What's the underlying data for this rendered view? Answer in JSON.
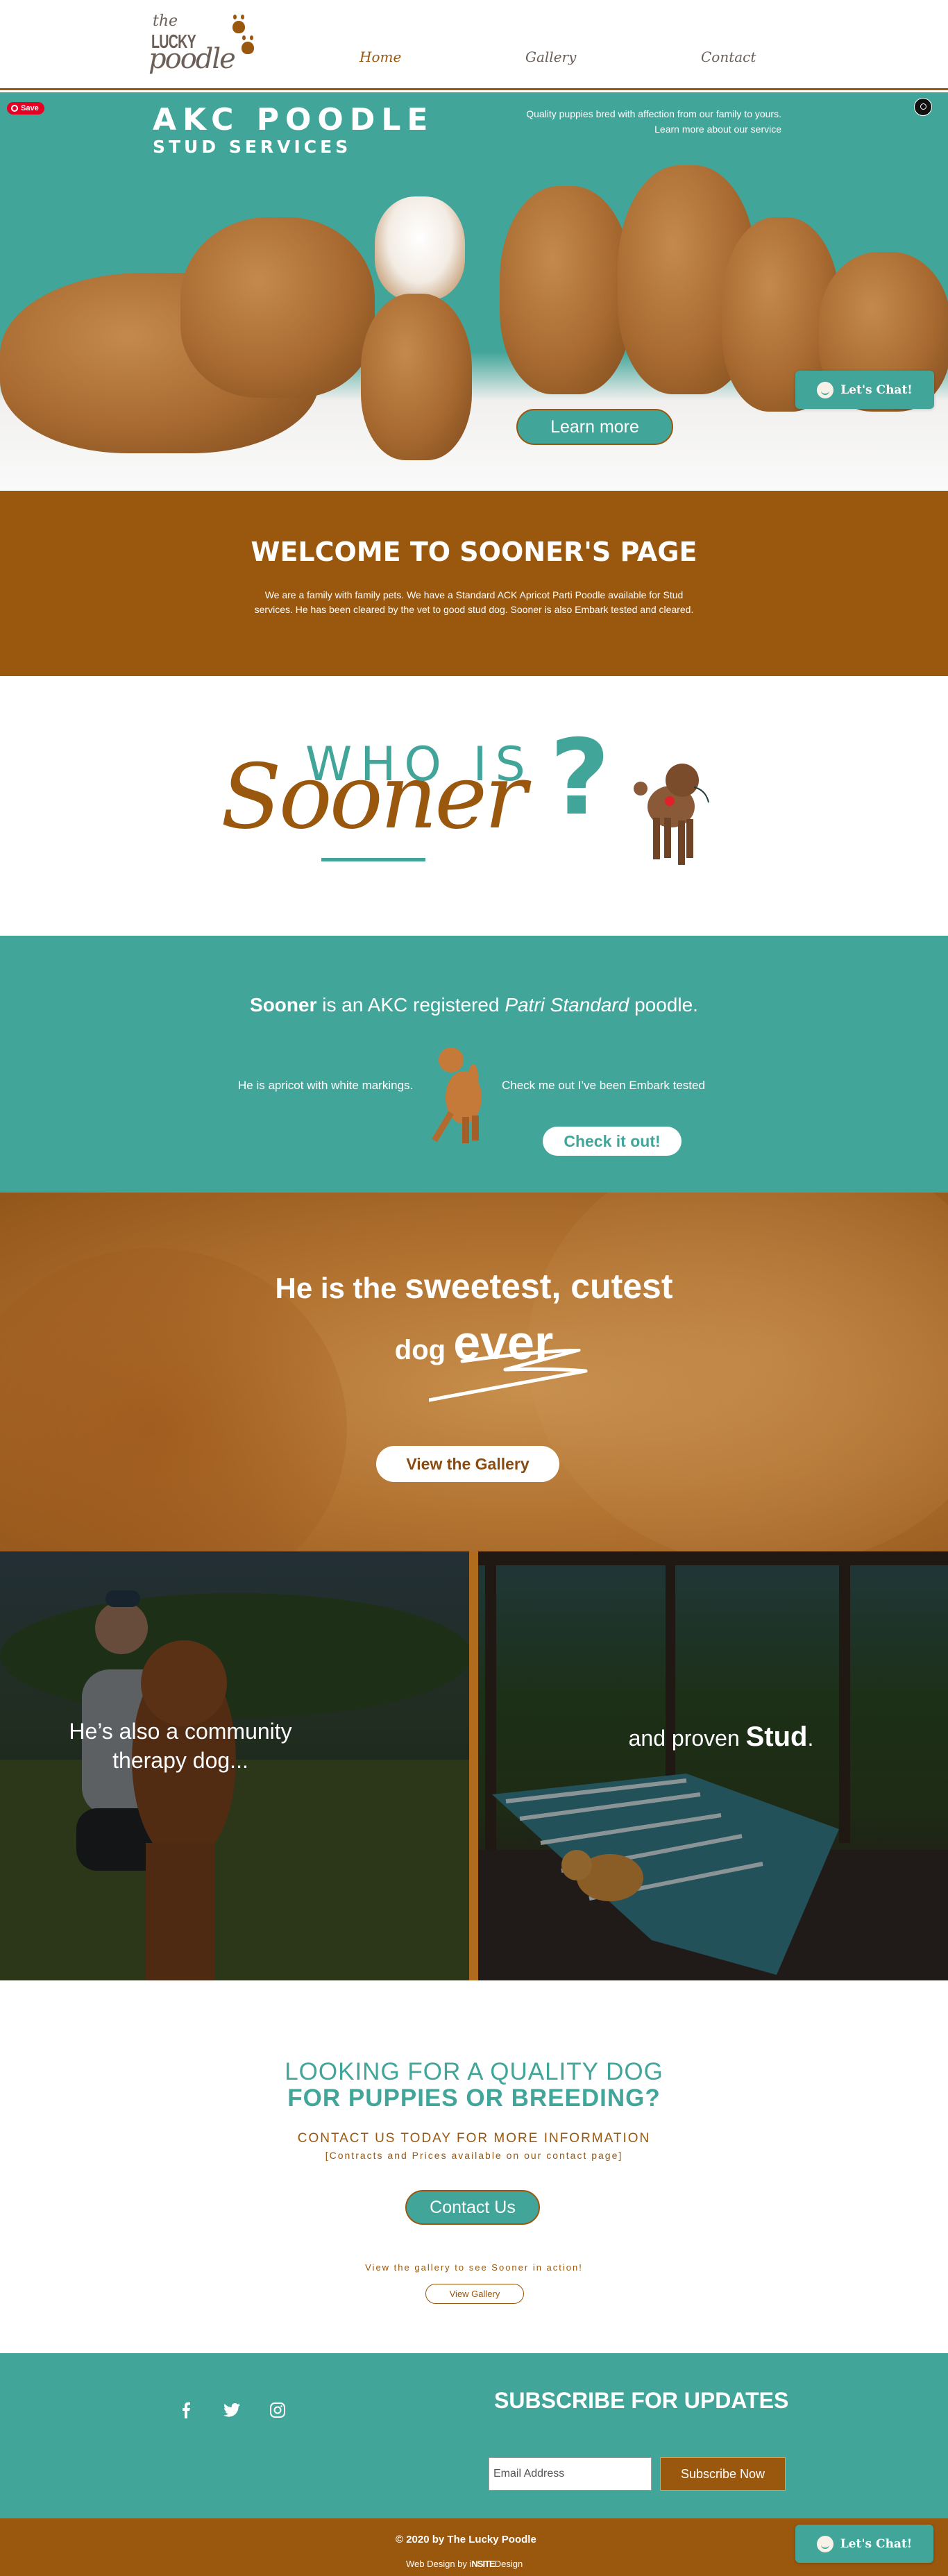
{
  "brand": {
    "logo_the": "the",
    "logo_lucky": "LUCKY",
    "logo_poodle": "poodle"
  },
  "nav": {
    "items": [
      {
        "label": "Home",
        "active": true
      },
      {
        "label": "Gallery",
        "active": false
      },
      {
        "label": "Contact",
        "active": false
      }
    ]
  },
  "hero": {
    "save_label": "Save",
    "title_line1": "AKC POODLE",
    "title_line2": "STUD SERVICES",
    "tagline_line1": "Quality puppies bred with affection from our family to yours.",
    "tagline_line2": "Learn more about our service",
    "learn_more_label": "Learn more",
    "chat_label": "Let's Chat!"
  },
  "welcome": {
    "heading": "WELCOME TO SOONER'S PAGE",
    "body": "We are a family with family pets.  We have a Standard ACK Apricot Parti Poodle available for Stud services.  He has been cleared by the vet to good stud dog.  Sooner is also Embark tested and cleared."
  },
  "who_is": {
    "who_text": "WHO IS",
    "name_text": "Sooner",
    "question_mark": "?"
  },
  "about": {
    "name_bold": "Sooner",
    "intro_mid": " is an AKC registered ",
    "intro_italic": "Patri Standard",
    "intro_end": " poodle.",
    "left_text": "He is apricot with white markings.",
    "right_text": "Check me out I’ve been Embark tested",
    "check_label": "Check it out!"
  },
  "sweetest": {
    "line1_a": "He is the ",
    "line1_b": "sweetest, cutest",
    "line2_a": "dog ",
    "line2_b": "ever",
    "gallery_label": "View the Gallery"
  },
  "photos": {
    "left_line1": "He’s  also a community",
    "left_line2": "therapy dog...",
    "right_a": "and proven ",
    "right_bold": "Stud",
    "right_end": "."
  },
  "cta": {
    "heading_line1": "LOOKING FOR A QUALITY DOG",
    "heading_line2": "FOR PUPPIES OR BREEDING?",
    "sub": "CONTACT US TODAY FOR MORE INFORMATION",
    "sub2": "[Contracts and Prices available on our contact page]",
    "contact_label": "Contact Us",
    "gallery_text": "View the gallery to see Sooner in action!",
    "gallery_label": "View Gallery"
  },
  "footer": {
    "social": [
      {
        "icon": "facebook-icon",
        "glyph": "f"
      },
      {
        "icon": "twitter-icon",
        "glyph": "🐦"
      },
      {
        "icon": "instagram-icon",
        "glyph": "◎"
      }
    ],
    "subscribe_title": "SUBSCRIBE FOR UPDATES",
    "email_placeholder": "Email Address",
    "subscribe_label": "Subscribe Now",
    "copyright": "© 2020 by The Lucky Poodle",
    "credit_prefix": "Web Design by i",
    "credit_bold": "NSITE",
    "credit_suffix": "Design",
    "chat_label": "Let's Chat!"
  },
  "colors": {
    "teal": "#42a59a",
    "brown": "#9a570e",
    "pinterest": "#e60023"
  }
}
